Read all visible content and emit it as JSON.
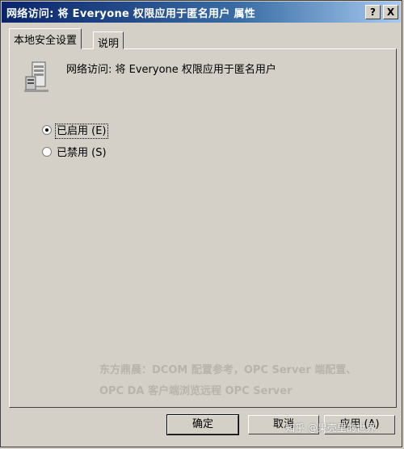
{
  "window": {
    "title": "网络访问: 将 Everyone 权限应用于匿名用户 属性",
    "help_btn": "?",
    "close_btn": "X"
  },
  "tabs": [
    {
      "label": "本地安全设置",
      "active": true
    },
    {
      "label": "说明",
      "active": false
    }
  ],
  "policy": {
    "icon": "server-policy-icon",
    "title": "网络访问: 将 Everyone 权限应用于匿名用户"
  },
  "options": [
    {
      "label": "已启用 (E)",
      "checked": true
    },
    {
      "label": "已禁用 (S)",
      "checked": false
    }
  ],
  "watermark": {
    "line1": "东方鼎晨：DCOM 配置参考，OPC Server 端配置、",
    "line2": "OPC DA 客户端浏览远程 OPC Server",
    "corner": "知乎 @果壳里的世界"
  },
  "buttons": {
    "ok": "确定",
    "cancel": "取消",
    "apply": "应用 (A)"
  }
}
